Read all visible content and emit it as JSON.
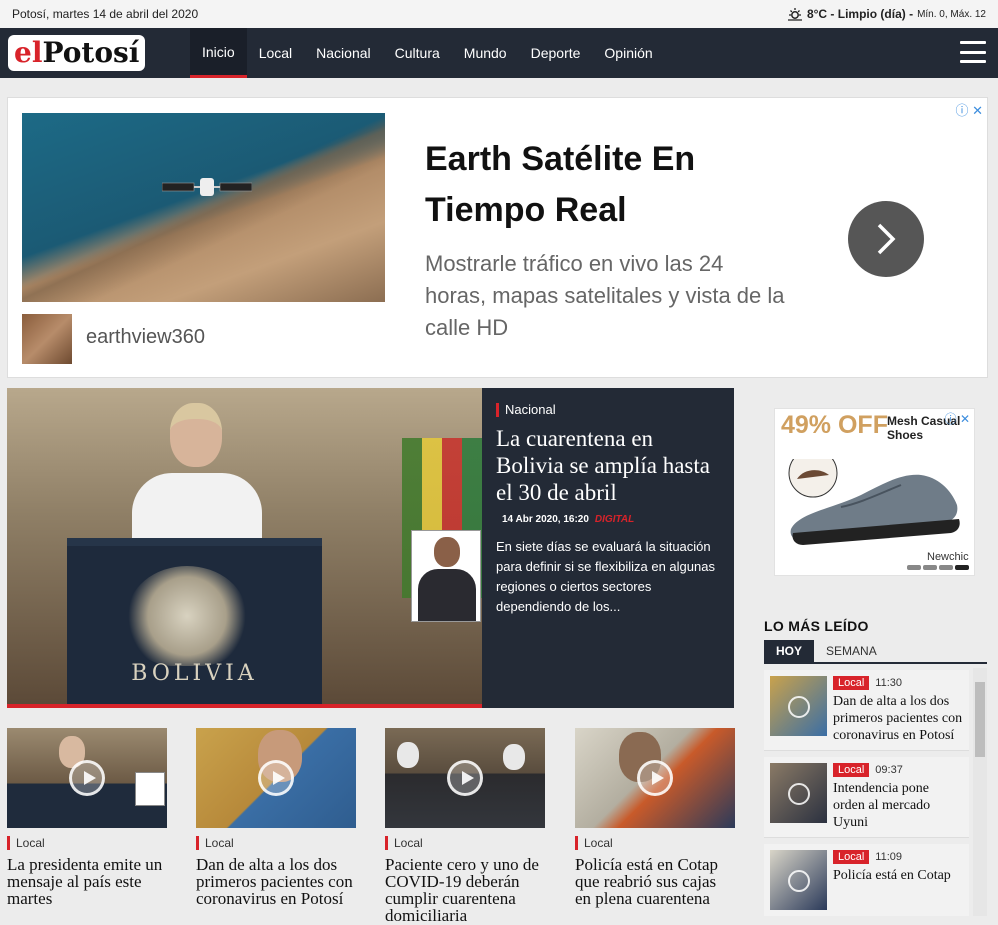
{
  "topbar": {
    "date": "Potosí, martes 14 de abril del 2020",
    "weather_main": "8°C - Limpio (día) -",
    "weather_minmax": "Mín. 0, Máx. 12"
  },
  "nav": {
    "logo_el": "el",
    "logo_name": "Potosí",
    "items": [
      "Inicio",
      "Local",
      "Nacional",
      "Cultura",
      "Mundo",
      "Deporte",
      "Opinión"
    ],
    "active": "Inicio"
  },
  "ad_top": {
    "title": "Earth Satélite En Tiempo Real",
    "description": "Mostrarle tráfico en vivo las 24 horas, mapas satelitales y vista de la calle HD",
    "brand": "earthview360"
  },
  "hero": {
    "category": "Nacional",
    "title": "La cuarentena en Bolivia se amplía hasta el 30 de abril",
    "date": "14 Abr 2020, 16:20",
    "source": "DIGITAL",
    "lead": "En siete días se evaluará la situación para definir si se flexibiliza en algunas regiones o ciertos sectores dependiendo de los...",
    "podium_text": "BOLIVIA"
  },
  "cards": [
    {
      "category": "Local",
      "title": "La presidenta emite un mensaje al país este martes"
    },
    {
      "category": "Local",
      "title": "Dan de alta a los dos primeros pacientes con coronavirus en Potosí"
    },
    {
      "category": "Local",
      "title": "Paciente cero y uno de COVID-19 deberán cumplir cuarentena domiciliaria"
    },
    {
      "category": "Local",
      "title": "Policía está en Cotap que reabrió sus cajas en plena cuarentena"
    }
  ],
  "ad_side": {
    "discount": "49% OFF",
    "title": "Mesh Casual Shoes",
    "brand": "Newchic"
  },
  "most_read": {
    "heading": "LO MÁS LEÍDO",
    "tabs": [
      "HOY",
      "SEMANA"
    ],
    "items": [
      {
        "category": "Local",
        "time": "11:30",
        "title": "Dan de alta a los dos primeros pacientes con coronavirus en Potosí"
      },
      {
        "category": "Local",
        "time": "09:37",
        "title": "Intendencia pone orden al mercado Uyuni"
      },
      {
        "category": "Local",
        "time": "11:09",
        "title": "Policía está en Cotap"
      }
    ]
  },
  "colors": {
    "accent": "#d8232a",
    "nav_bg": "#232a36",
    "page_bg": "#ececec"
  }
}
